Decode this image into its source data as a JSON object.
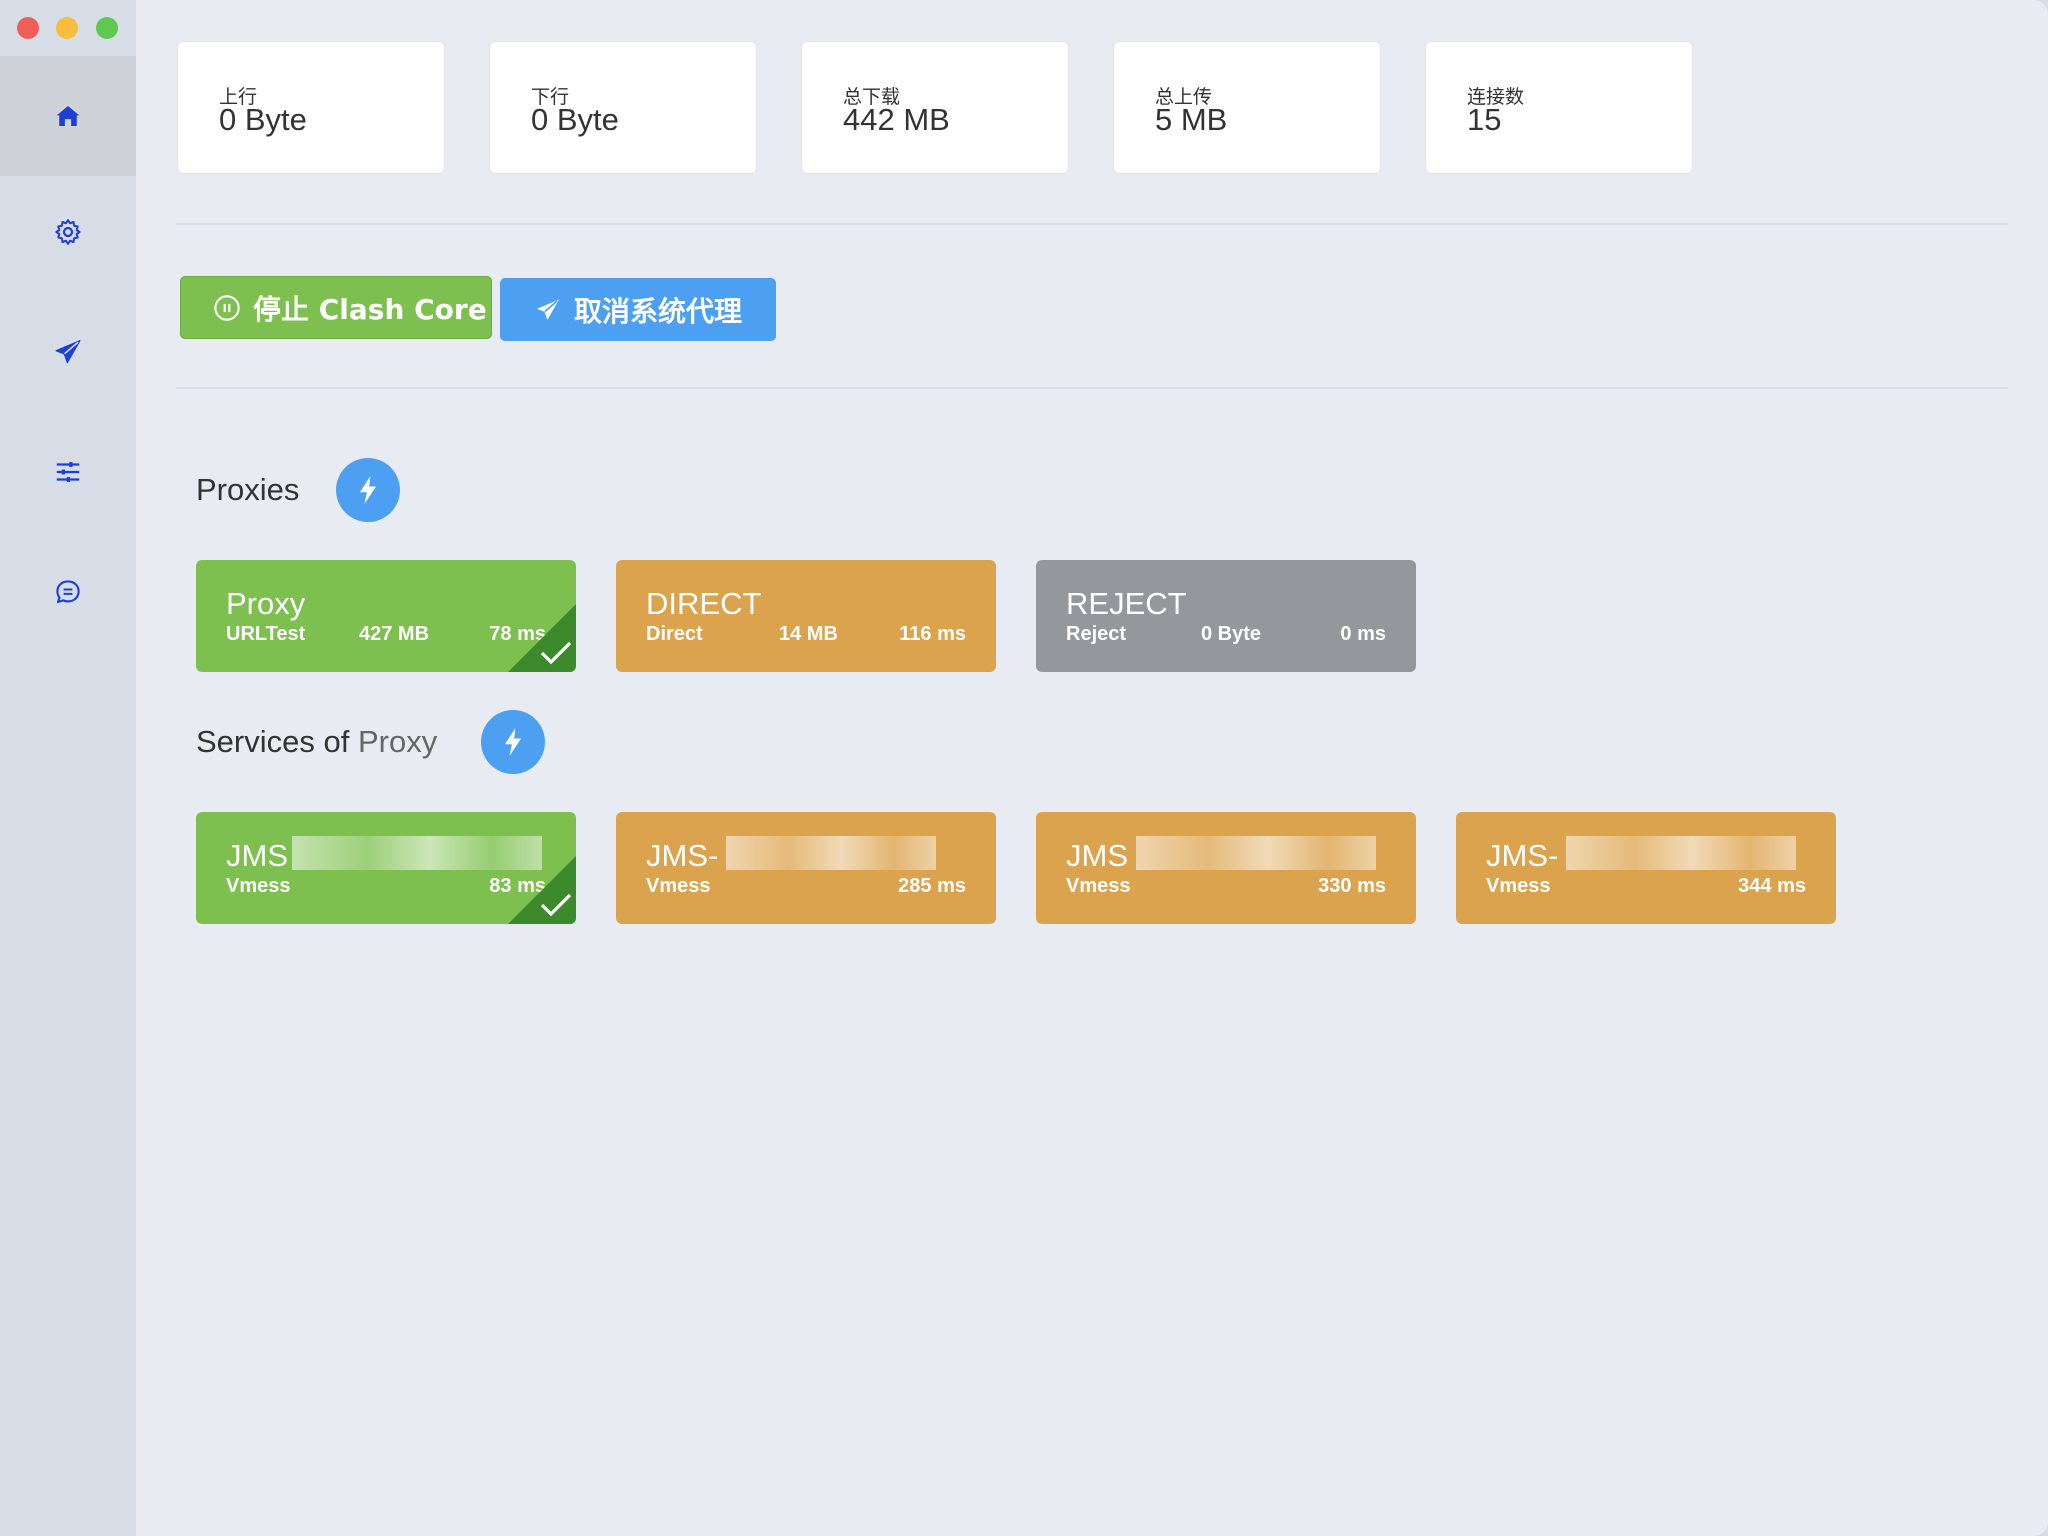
{
  "stats": [
    {
      "label": "上行",
      "value": "0 Byte"
    },
    {
      "label": "下行",
      "value": "0 Byte"
    },
    {
      "label": "总下载",
      "value": "442 MB"
    },
    {
      "label": "总上传",
      "value": "5 MB"
    },
    {
      "label": "连接数",
      "value": "15"
    }
  ],
  "sidebar": {
    "items": [
      {
        "icon": "home-icon",
        "active": true
      },
      {
        "icon": "gear-icon",
        "active": false
      },
      {
        "icon": "paper-plane-icon",
        "active": false
      },
      {
        "icon": "sliders-icon",
        "active": false
      },
      {
        "icon": "chat-icon",
        "active": false
      }
    ]
  },
  "actions": {
    "stop_label": "停止 Clash Core",
    "cancel_proxy_label": "取消系统代理"
  },
  "proxies_section": {
    "title": "Proxies",
    "items": [
      {
        "name": "Proxy",
        "type": "URLTest",
        "size": "427 MB",
        "latency": "78 ms",
        "color": "#7dc04f",
        "selected": true
      },
      {
        "name": "DIRECT",
        "type": "Direct",
        "size": "14 MB",
        "latency": "116 ms",
        "color": "#dca34e",
        "selected": false
      },
      {
        "name": "REJECT",
        "type": "Reject",
        "size": "0 Byte",
        "latency": "0 ms",
        "color": "#94979c",
        "selected": false
      }
    ]
  },
  "services_section": {
    "title_prefix": "Services of",
    "title_group": "Proxy",
    "items": [
      {
        "name": "JMS",
        "type": "Vmess",
        "latency": "83 ms",
        "color": "#7dc04f",
        "selected": true
      },
      {
        "name": "JMS-",
        "type": "Vmess",
        "latency": "285 ms",
        "color": "#dca34e",
        "selected": false
      },
      {
        "name": "JMS",
        "type": "Vmess",
        "latency": "330 ms",
        "color": "#dca34e",
        "selected": false
      },
      {
        "name": "JMS-",
        "type": "Vmess",
        "latency": "344 ms",
        "color": "#dca34e",
        "selected": false
      }
    ]
  },
  "colors": {
    "accent_blue": "#4d9ff2",
    "green": "#7dc04f",
    "orange": "#dca34e",
    "gray": "#94979c",
    "nav_icon": "#1d3fd6"
  }
}
